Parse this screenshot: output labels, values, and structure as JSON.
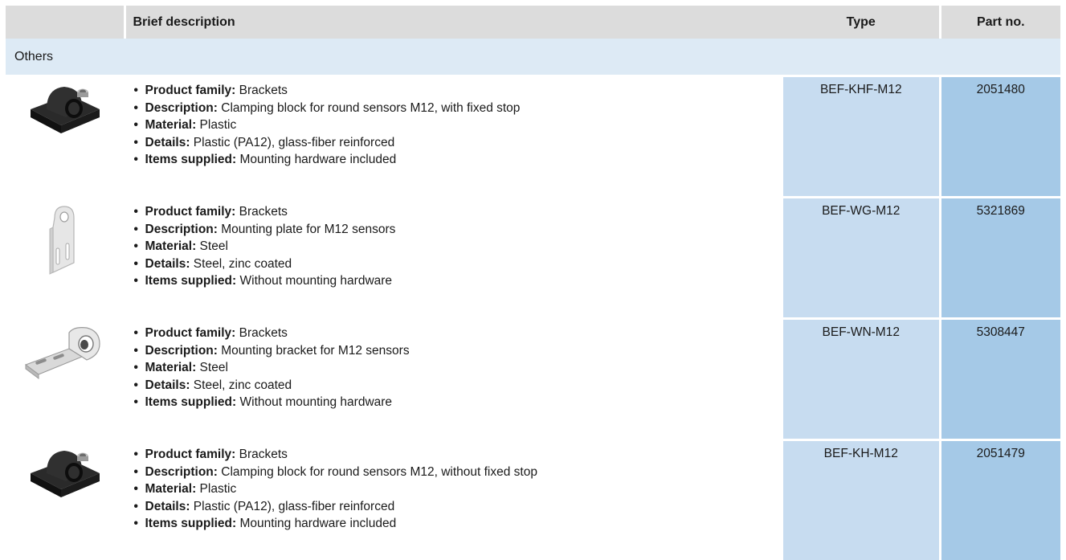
{
  "header": {
    "col_desc": "Brief description",
    "col_type": "Type",
    "col_part": "Part no."
  },
  "group_label": "Others",
  "rows": [
    {
      "image_icon": "clamping-block-image",
      "type": "BEF-KHF-M12",
      "part_no": "2051480",
      "items": [
        {
          "label": "Product family:",
          "value": " Brackets"
        },
        {
          "label": "Description:",
          "value": " Clamping block for round sensors M12, with fixed stop"
        },
        {
          "label": "Material:",
          "value": " Plastic"
        },
        {
          "label": "Details:",
          "value": " Plastic (PA12), glass-fiber reinforced"
        },
        {
          "label": "Items supplied:",
          "value": " Mounting hardware included"
        }
      ]
    },
    {
      "image_icon": "mounting-plate-image",
      "type": "BEF-WG-M12",
      "part_no": "5321869",
      "items": [
        {
          "label": "Product family:",
          "value": " Brackets"
        },
        {
          "label": "Description:",
          "value": " Mounting plate for M12 sensors"
        },
        {
          "label": "Material:",
          "value": " Steel"
        },
        {
          "label": "Details:",
          "value": " Steel, zinc coated"
        },
        {
          "label": "Items supplied:",
          "value": " Without mounting hardware"
        }
      ]
    },
    {
      "image_icon": "mounting-bracket-image",
      "type": "BEF-WN-M12",
      "part_no": "5308447",
      "items": [
        {
          "label": "Product family:",
          "value": " Brackets"
        },
        {
          "label": "Description:",
          "value": " Mounting bracket for M12 sensors"
        },
        {
          "label": "Material:",
          "value": " Steel"
        },
        {
          "label": "Details:",
          "value": " Steel, zinc coated"
        },
        {
          "label": "Items supplied:",
          "value": " Without mounting hardware"
        }
      ]
    },
    {
      "image_icon": "clamping-block-image",
      "type": "BEF-KH-M12",
      "part_no": "2051479",
      "items": [
        {
          "label": "Product family:",
          "value": " Brackets"
        },
        {
          "label": "Description:",
          "value": " Clamping block for round sensors M12, without fixed stop"
        },
        {
          "label": "Material:",
          "value": " Plastic"
        },
        {
          "label": "Details:",
          "value": " Plastic (PA12), glass-fiber reinforced"
        },
        {
          "label": "Items supplied:",
          "value": " Mounting hardware included"
        }
      ]
    }
  ]
}
